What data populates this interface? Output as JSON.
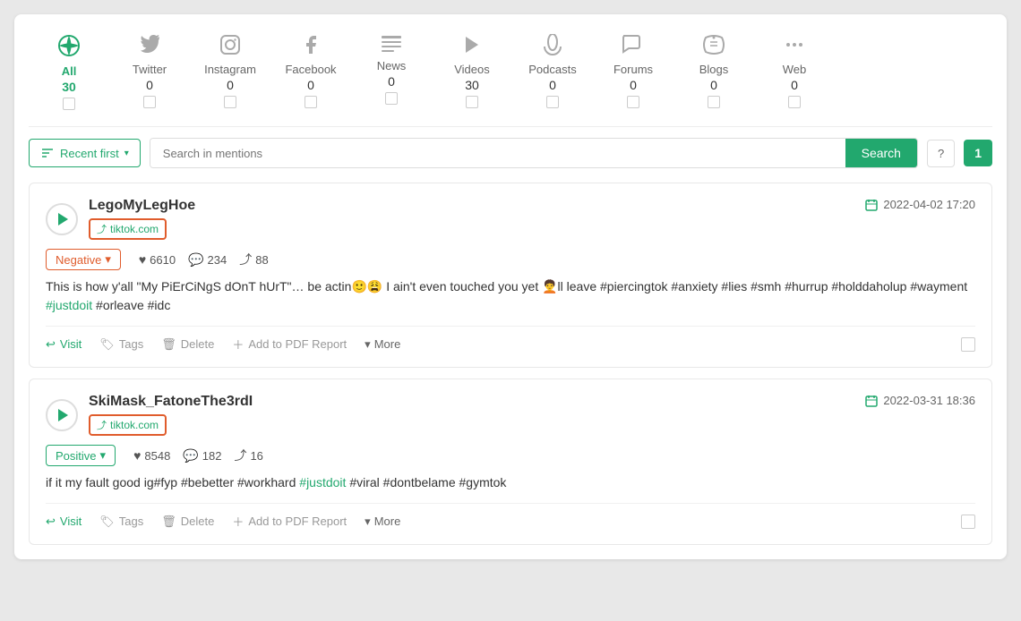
{
  "sources": [
    {
      "id": "all",
      "label": "All",
      "count": 30,
      "active": true,
      "icon": "🌐"
    },
    {
      "id": "twitter",
      "label": "Twitter",
      "count": 0,
      "active": false,
      "icon": "🐦"
    },
    {
      "id": "instagram",
      "label": "Instagram",
      "count": 0,
      "active": false,
      "icon": "📷"
    },
    {
      "id": "facebook",
      "label": "Facebook",
      "count": 0,
      "active": false,
      "icon": "👤"
    },
    {
      "id": "news",
      "label": "News",
      "count": 0,
      "active": false,
      "icon": "≡"
    },
    {
      "id": "videos",
      "label": "Videos",
      "count": 30,
      "active": false,
      "icon": "▶"
    },
    {
      "id": "podcasts",
      "label": "Podcasts",
      "count": 0,
      "active": false,
      "icon": "🔊"
    },
    {
      "id": "forums",
      "label": "Forums",
      "count": 0,
      "active": false,
      "icon": "💬"
    },
    {
      "id": "blogs",
      "label": "Blogs",
      "count": 0,
      "active": false,
      "icon": "📡"
    },
    {
      "id": "web",
      "label": "Web",
      "count": 0,
      "active": false,
      "icon": "⋯"
    }
  ],
  "toolbar": {
    "sort_label": "Recent first",
    "search_placeholder": "Search in mentions",
    "search_btn_label": "Search",
    "help_label": "?",
    "page_label": "1"
  },
  "cards": [
    {
      "username": "LegoMyLegHoe",
      "source_name": "tiktok.com",
      "date": "2022-04-02 17:20",
      "sentiment": "Negative",
      "sentiment_type": "negative",
      "likes": "6610",
      "comments": "234",
      "shares": "88",
      "body": "This is how y'all \"My PiErCiNgS dOnT hUrT\"… be actin🙂😩 I ain't even touched you yet 🧑‍🦱ll leave #piercingtok #anxiety #lies #smh #hurrup #holddaholup #wayment #justdoit #orleave #idc",
      "hashtag_highlight": "#justdoit",
      "actions": {
        "visit": "Visit",
        "tags": "Tags",
        "delete": "Delete",
        "pdf": "Add to PDF Report",
        "more": "More"
      }
    },
    {
      "username": "SkiMask_FatoneThe3rdI",
      "source_name": "tiktok.com",
      "date": "2022-03-31 18:36",
      "sentiment": "Positive",
      "sentiment_type": "positive",
      "likes": "8548",
      "comments": "182",
      "shares": "16",
      "body": "if it my fault good ig#fyp #bebetter #workhard #justdoit #viral #dontbelame #gymtok",
      "hashtag_highlight": "#justdoit",
      "actions": {
        "visit": "Visit",
        "tags": "Tags",
        "delete": "Delete",
        "pdf": "Add to PDF Report",
        "more": "More"
      }
    }
  ],
  "colors": {
    "green": "#22a86e",
    "orange": "#e05c2c"
  }
}
